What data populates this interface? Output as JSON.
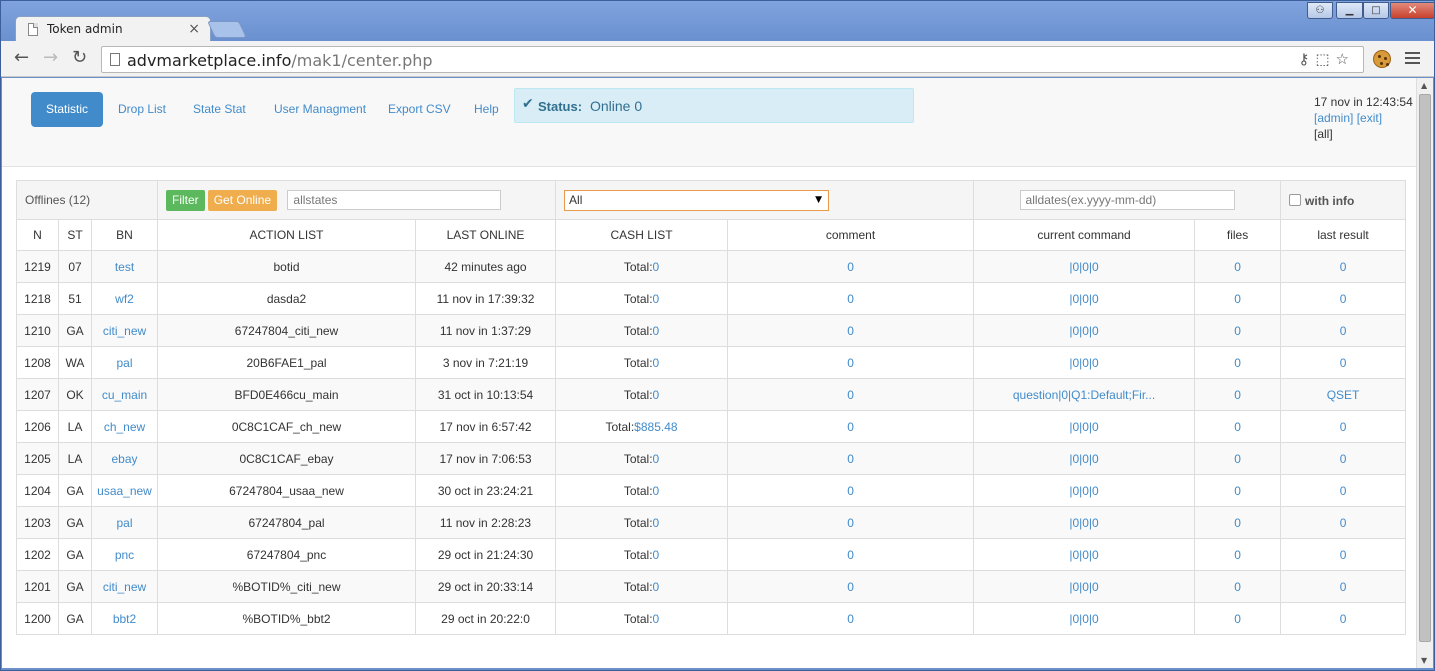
{
  "browser": {
    "tab_title": "Token admin",
    "tab_close": "×",
    "url_host": "advmarketplace.info",
    "url_path": "/mak1/center.php",
    "window_buttons": {
      "user": "⚇",
      "min": "▁",
      "max": "□",
      "close": "✕"
    },
    "nav": {
      "back": "←",
      "forward": "→",
      "reload": "↻"
    },
    "omnibox_icons": "⚷⬚☆"
  },
  "nav": {
    "items": [
      "Statistic",
      "Drop List",
      "State Stat",
      "User Managment",
      "Export CSV",
      "Help"
    ],
    "active": "Statistic"
  },
  "status": {
    "icon": "✔",
    "label": "Status:",
    "value": "Online 0"
  },
  "user": {
    "datetime": "17 nov in 12:43:54",
    "admin": "[admin]",
    "exit": "[exit]",
    "all": "[all]"
  },
  "filters": {
    "offlines": "Offlines (12)",
    "filter_btn": "Filter",
    "get_online_btn": "Get Online",
    "states_placeholder": "allstates",
    "action_select": "All",
    "select_arrow": "▼",
    "dates_placeholder": "alldates(ex.yyyy-mm-dd)",
    "with_info": "with info"
  },
  "columns": [
    "N",
    "ST",
    "BN",
    "ACTION LIST",
    "LAST ONLINE",
    "CASH LIST",
    "comment",
    "current command",
    "files",
    "last result"
  ],
  "rows": [
    {
      "n": "1219",
      "st": "07",
      "bn": "test",
      "action": "botid",
      "last_online": "42 minutes ago",
      "cash_label": "Total:",
      "cash": "0",
      "comment": "0",
      "command": "|0|0|0",
      "files": "0",
      "result": "0"
    },
    {
      "n": "1218",
      "st": "51",
      "bn": "wf2",
      "action": "dasda2",
      "last_online": "11 nov in 17:39:32",
      "cash_label": "Total:",
      "cash": "0",
      "comment": "0",
      "command": "|0|0|0",
      "files": "0",
      "result": "0"
    },
    {
      "n": "1210",
      "st": "GA",
      "bn": "citi_new",
      "action": "67247804_citi_new",
      "last_online": "11 nov in 1:37:29",
      "cash_label": "Total:",
      "cash": "0",
      "comment": "0",
      "command": "|0|0|0",
      "files": "0",
      "result": "0"
    },
    {
      "n": "1208",
      "st": "WA",
      "bn": "pal",
      "action": "20B6FAE1_pal",
      "last_online": "3 nov in 7:21:19",
      "cash_label": "Total:",
      "cash": "0",
      "comment": "0",
      "command": "|0|0|0",
      "files": "0",
      "result": "0"
    },
    {
      "n": "1207",
      "st": "OK",
      "bn": "cu_main",
      "action": "BFD0E466cu_main",
      "last_online": "31 oct in 10:13:54",
      "cash_label": "Total:",
      "cash": "0",
      "comment": "0",
      "command": "question|0|Q1:Default;Fir...",
      "files": "0",
      "result": "QSET"
    },
    {
      "n": "1206",
      "st": "LA",
      "bn": "ch_new",
      "action": "0C8C1CAF_ch_new",
      "last_online": "17 nov in 6:57:42",
      "cash_label": "Total:",
      "cash": "$885.48",
      "comment": "0",
      "command": "|0|0|0",
      "files": "0",
      "result": "0"
    },
    {
      "n": "1205",
      "st": "LA",
      "bn": "ebay",
      "action": "0C8C1CAF_ebay",
      "last_online": "17 nov in 7:06:53",
      "cash_label": "Total:",
      "cash": "0",
      "comment": "0",
      "command": "|0|0|0",
      "files": "0",
      "result": "0"
    },
    {
      "n": "1204",
      "st": "GA",
      "bn": "usaa_new",
      "action": "67247804_usaa_new",
      "last_online": "30 oct in 23:24:21",
      "cash_label": "Total:",
      "cash": "0",
      "comment": "0",
      "command": "|0|0|0",
      "files": "0",
      "result": "0"
    },
    {
      "n": "1203",
      "st": "GA",
      "bn": "pal",
      "action": "67247804_pal",
      "last_online": "11 nov in 2:28:23",
      "cash_label": "Total:",
      "cash": "0",
      "comment": "0",
      "command": "|0|0|0",
      "files": "0",
      "result": "0"
    },
    {
      "n": "1202",
      "st": "GA",
      "bn": "pnc",
      "action": "67247804_pnc",
      "last_online": "29 oct in 21:24:30",
      "cash_label": "Total:",
      "cash": "0",
      "comment": "0",
      "command": "|0|0|0",
      "files": "0",
      "result": "0"
    },
    {
      "n": "1201",
      "st": "GA",
      "bn": "citi_new",
      "action": "%BOTID%_citi_new",
      "last_online": "29 oct in 20:33:14",
      "cash_label": "Total:",
      "cash": "0",
      "comment": "0",
      "command": "|0|0|0",
      "files": "0",
      "result": "0"
    },
    {
      "n": "1200",
      "st": "GA",
      "bn": "bbt2",
      "action": "%BOTID%_bbt2",
      "last_online": "29 oct in 20:22:0",
      "cash_label": "Total:",
      "cash": "0",
      "comment": "0",
      "command": "|0|0|0",
      "files": "0",
      "result": "0"
    }
  ],
  "scrollbar": {
    "up": "▲",
    "down": "▼"
  },
  "colors": {
    "link": "#428bca",
    "active_pill": "#428bca",
    "filter_btn": "#5cb85c",
    "online_btn": "#f0ad4e",
    "status_bg": "#d9edf7"
  }
}
